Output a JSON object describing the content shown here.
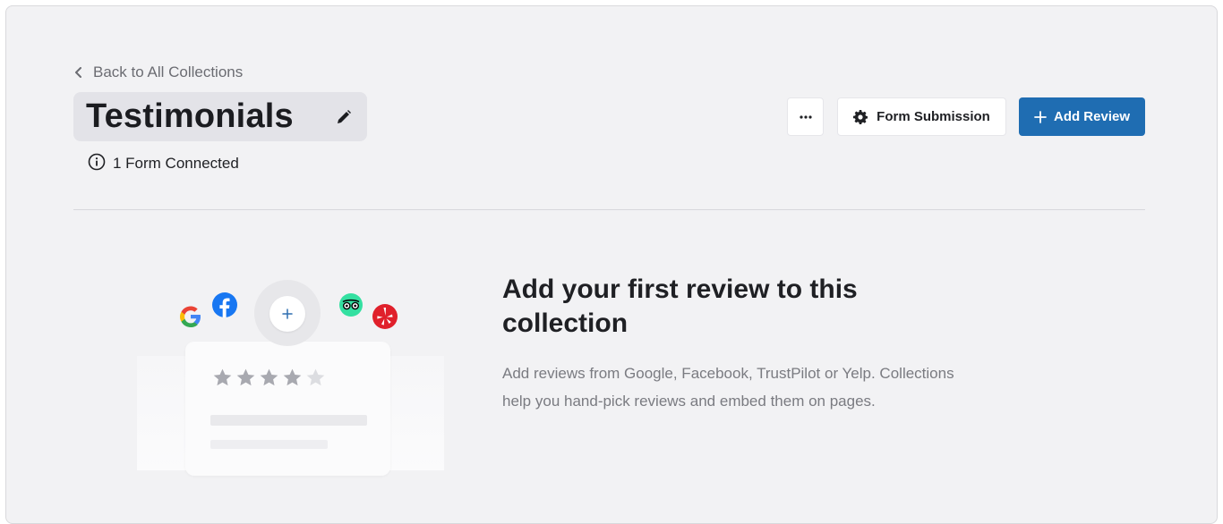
{
  "header": {
    "back_label": "Back to All Collections",
    "title": "Testimonials",
    "forms_connected": "1 Form Connected"
  },
  "actions": {
    "more_label": "···",
    "form_submission_label": "Form Submission",
    "add_review_label": "Add Review",
    "add_review_color": "#1f6db2"
  },
  "empty_state": {
    "heading": "Add your first review to this collection",
    "description": "Add reviews from Google, Facebook, TrustPilot or Yelp. Collections help you hand-pick reviews and embed them on pages.",
    "illustration": {
      "rating": 4,
      "max_rating": 5,
      "brand_icons": [
        "google-icon",
        "facebook-icon",
        "tripadvisor-icon",
        "yelp-icon"
      ]
    }
  }
}
